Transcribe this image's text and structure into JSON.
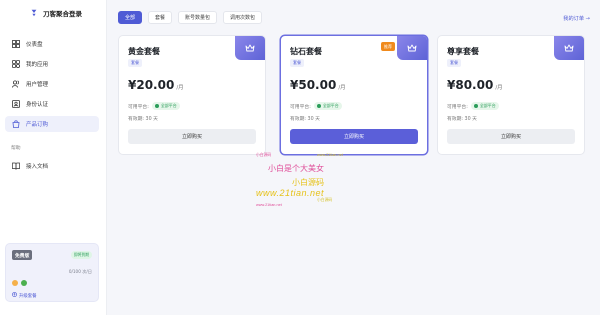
{
  "app": {
    "name": "刀客聚合登录"
  },
  "sidebar": {
    "items": [
      {
        "label": "仪表盘",
        "icon": "grid-icon"
      },
      {
        "label": "我的应用",
        "icon": "apps-icon"
      },
      {
        "label": "用户管理",
        "icon": "users-icon"
      },
      {
        "label": "身份认证",
        "icon": "id-card-icon"
      },
      {
        "label": "产品订购",
        "icon": "bag-icon"
      }
    ],
    "section_label": "帮助",
    "help_items": [
      {
        "label": "接入文档",
        "icon": "book-icon"
      }
    ],
    "plan": {
      "badge": "免费版",
      "status": "即将到期",
      "usage": "0/100 次/日",
      "upgrade": "升级套餐"
    }
  },
  "tabs": [
    "全部",
    "套餐",
    "账号数量包",
    "调用次数包"
  ],
  "orders_link": "我的订单 →",
  "cards": [
    {
      "title": "黄金套餐",
      "tag": "套餐",
      "price": "¥20.00",
      "unit": "/月",
      "platform_label": "可用平台:",
      "platform_value": "全部平台",
      "valid": "有效期: 30 天",
      "button": "立即购买"
    },
    {
      "title": "钻石套餐",
      "tag": "套餐",
      "badge": "推荐",
      "price": "¥50.00",
      "unit": "/月",
      "platform_label": "可用平台:",
      "platform_value": "全部平台",
      "valid": "有效期: 30 天",
      "button": "立即购买"
    },
    {
      "title": "尊享套餐",
      "tag": "套餐",
      "price": "¥80.00",
      "unit": "/月",
      "platform_label": "可用平台:",
      "platform_value": "全部平台",
      "valid": "有效期: 30 天",
      "button": "立即购买"
    }
  ],
  "watermark": {
    "line1a": "小白源码",
    "line1b": "www.21tian.net",
    "line2": "小白是个大美女",
    "line3": "小白源码",
    "line4": "www.21tian.net",
    "line5a": "www.21tian.net",
    "line5b": "小白源码"
  },
  "colors": {
    "accent": "#4f5bd5",
    "badge": "#f08a1c",
    "success": "#2b9d5a"
  }
}
